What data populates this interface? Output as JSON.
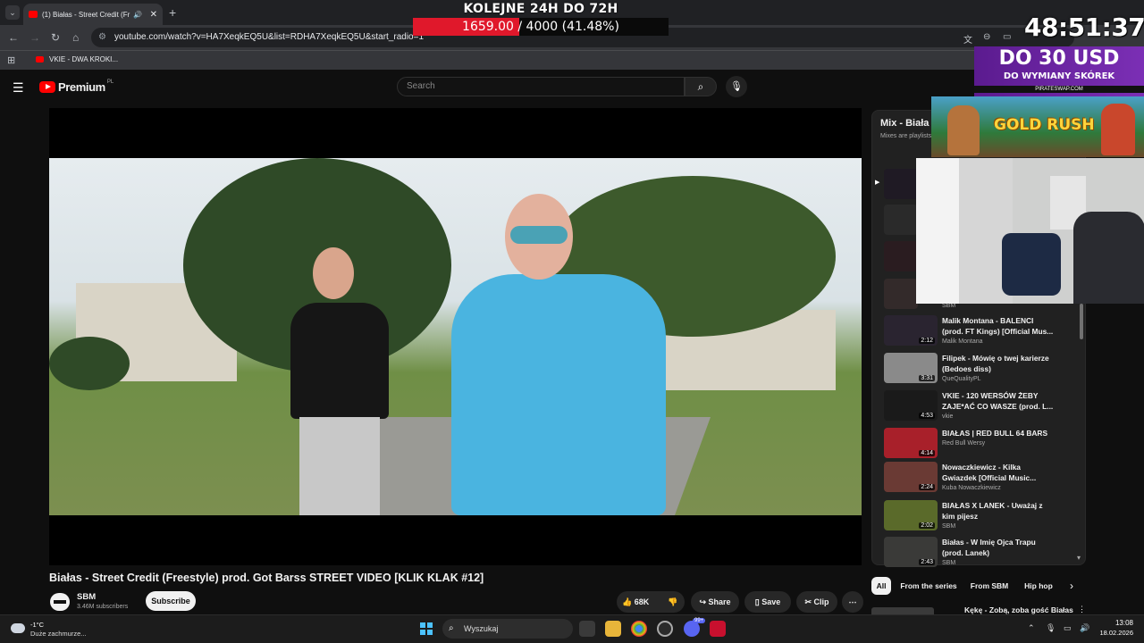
{
  "browser": {
    "tab_title": "(1) Białas - Street Credit (Fr",
    "url": "youtube.com/watch?v=HA7XeqkEQ5U&list=RDHA7XeqkEQ5U&start_radio=1",
    "bookmark": "VKIE - DWA KROKI..."
  },
  "overlay": {
    "goal_title": "KOLEJNE 24H DO 72H",
    "goal_current": "1659.00",
    "goal_rest": " / 4000 (41.48%)",
    "goal_progress": 0.4148,
    "timer": "48:51:37",
    "ad_big": "DO 30 USD",
    "ad_small": "DO WYMIANY SKÓREK",
    "ad_brand": "PIRATESWAP.COM",
    "ad2_title": "GOLD RUSH"
  },
  "youtube": {
    "logo_text": "Premium",
    "logo_country": "PL",
    "search_placeholder": "Search",
    "video_title": "Białas - Street Credit (Freestyle) prod. Got Barss STREET VIDEO [KLIK KLAK #12]",
    "channel_name": "SBM",
    "subscribers": "3.46M subscribers",
    "subscribe_label": "Subscribe",
    "likes": "68K",
    "share_label": "Share",
    "save_label": "Save",
    "clip_label": "Clip",
    "mix_title": "Mix - Biała",
    "mix_sub": "Mixes are playlists",
    "first_channel": "SBM",
    "playlist": [
      {
        "title": "Malik Montana - BALENCI (prod. FT Kings) [Official Mus...",
        "channel": "Malik Montana",
        "duration": "2:12",
        "color": "#2a2430"
      },
      {
        "title": "Filipek - Mówię o twej karierze (Bedoes diss)",
        "channel": "QueQualityPL",
        "duration": "3:31",
        "color": "#8a8a8a"
      },
      {
        "title": "VKIE - 120 WERSÓW ŻEBY ZAJE*AĆ CO WASZE (prod. L...",
        "channel": "vkie",
        "duration": "4:53",
        "color": "#1a1a1a"
      },
      {
        "title": "BIAŁAS | RED BULL 64 BARS",
        "channel": "Red Bull Wersy",
        "duration": "4:14",
        "color": "#a8202a"
      },
      {
        "title": "Nowaczkiewicz - Kilka Gwiazdek [Official Music...",
        "channel": "Kuba Nowaczkiewicz",
        "duration": "2:24",
        "color": "#6a3a34"
      },
      {
        "title": "BIAŁAS X LANEK - Uważaj z kim pijesz",
        "channel": "SBM",
        "duration": "2:02",
        "color": "#5a6a2a"
      },
      {
        "title": "Białas - W Imię Ojca Trapu (prod. Lanek)",
        "channel": "SBM",
        "duration": "2:43",
        "color": "#3a3a38"
      }
    ],
    "chips": [
      "All",
      "From the series",
      "From SBM",
      "Hip hop"
    ],
    "below_item": "Kękę - Zobą, zoba gość Białas"
  },
  "taskbar": {
    "temp": "-1°C",
    "weather_desc": "Duże zachmurze...",
    "search_label": "Wyszukaj",
    "time": "13:08",
    "date": "18.02.2026",
    "discord_badge": "99+"
  }
}
